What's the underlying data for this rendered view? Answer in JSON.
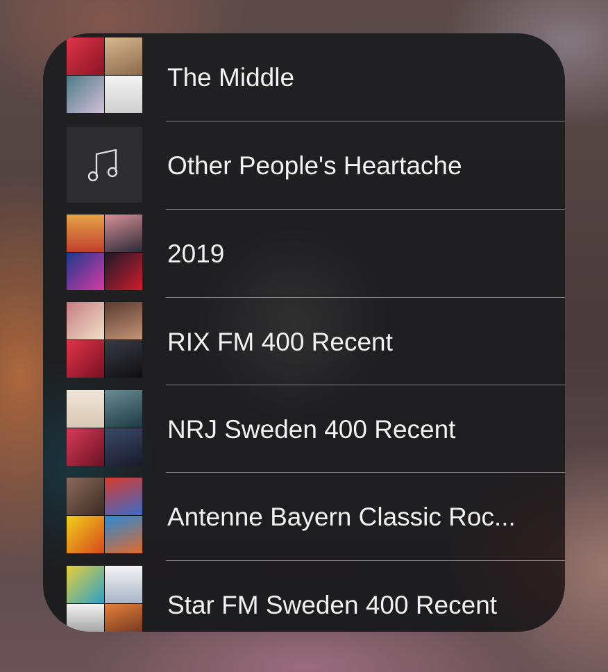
{
  "playlists": [
    {
      "title": "The Middle",
      "art": [
        "#c0262e",
        "#c9a77a",
        "#3c6a7a",
        "#e8e8e8"
      ]
    },
    {
      "title": "Other People's Heartache",
      "icon": "music-note-icon"
    },
    {
      "title": "2019",
      "art": [
        "#d88a3c",
        "#3a3a4a",
        "#2c6ad8",
        "#a0202c"
      ]
    },
    {
      "title": "RIX FM 400 Recent",
      "art": [
        "#b3686c",
        "#3a2a2e",
        "#c01c24",
        "#1e1e24"
      ]
    },
    {
      "title": "NRJ Sweden 400 Recent",
      "art": [
        "#e9ddcc",
        "#3d6b78",
        "#c8243c",
        "#2e3a58"
      ]
    },
    {
      "title": "Antenne Bayern Classic Roc...",
      "art": [
        "#6b4a3a",
        "#c03a2c",
        "#e8c81c",
        "#3a7acb"
      ]
    },
    {
      "title": "Star FM Sweden 400 Recent",
      "art": [
        "#3aa0c8",
        "#e8e8e8",
        "#f0f0f0",
        "#d86a1c"
      ]
    }
  ]
}
